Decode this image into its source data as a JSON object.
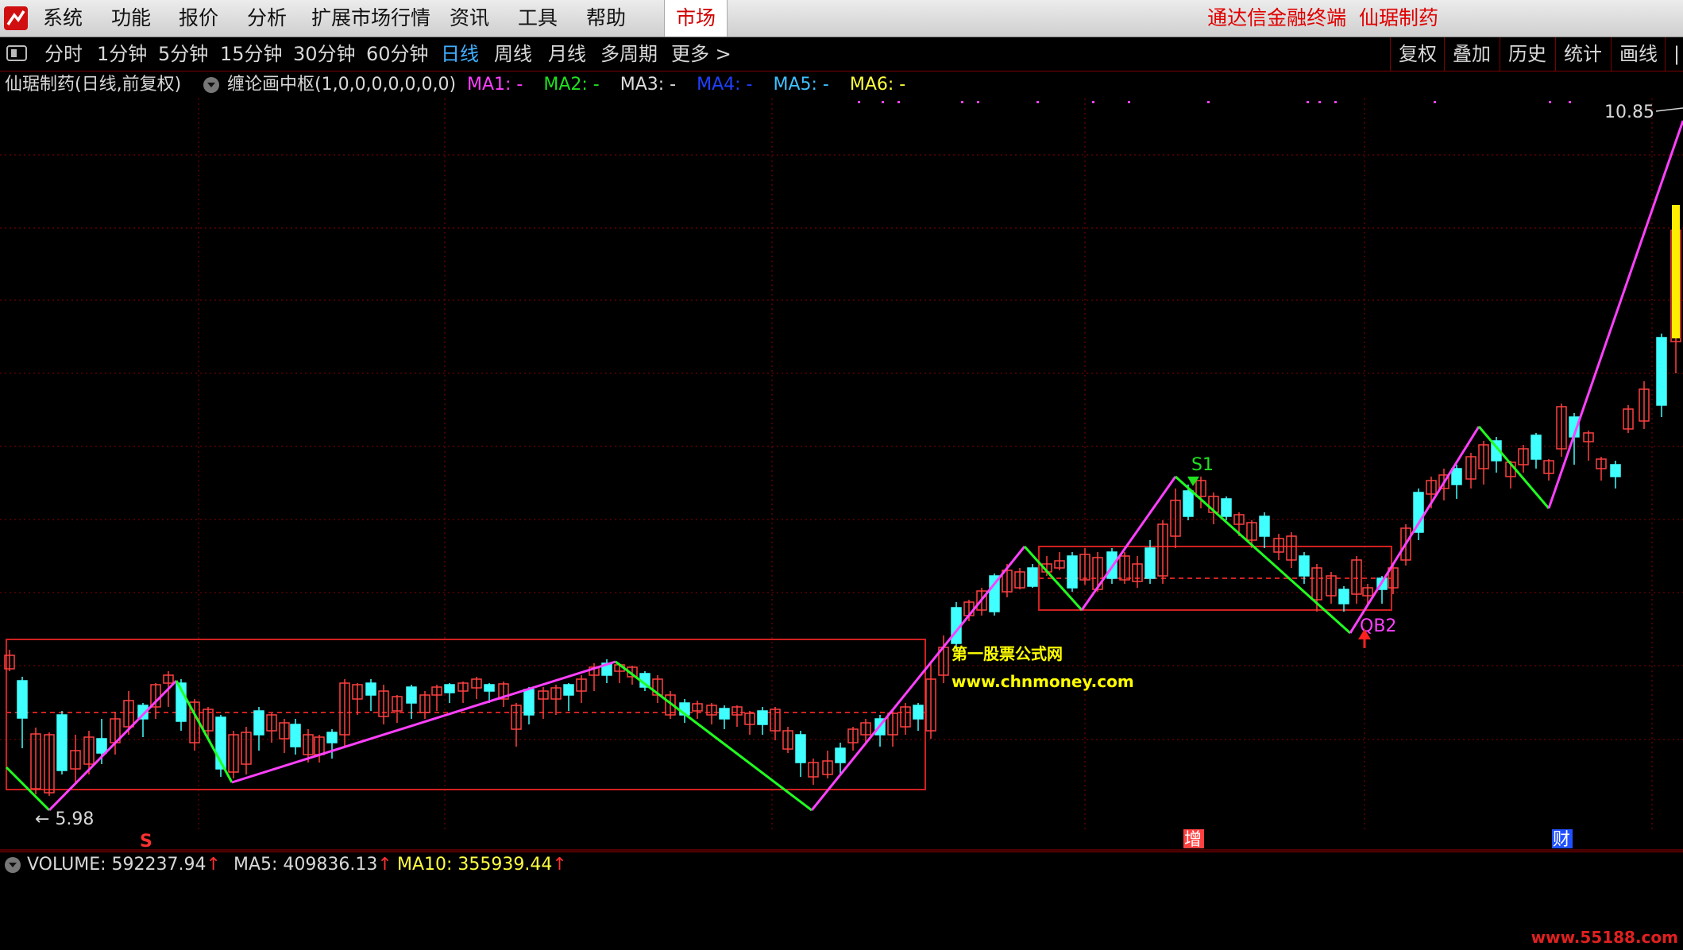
{
  "menubar": {
    "items": [
      "系统",
      "功能",
      "报价",
      "分析",
      "扩展市场行情",
      "资讯",
      "工具",
      "帮助"
    ],
    "market": "市场",
    "brand": "通达信金融终端",
    "stock": "仙琚制药"
  },
  "periods": {
    "items": [
      "分时",
      "1分钟",
      "5分钟",
      "15分钟",
      "30分钟",
      "60分钟",
      "日线",
      "周线",
      "月线",
      "多周期",
      "更多 >"
    ],
    "active": "日线"
  },
  "tools": [
    "复权",
    "叠加",
    "历史",
    "统计",
    "画线",
    "|"
  ],
  "infobar": {
    "title": "仙琚制药(日线,前复权)",
    "indicator": "缠论画中枢(1,0,0,0,0,0,0,0)",
    "ma_labels": [
      {
        "text": "MA1: -",
        "color": "#ff40ff"
      },
      {
        "text": "MA2: -",
        "color": "#20e020"
      },
      {
        "text": "MA3: -",
        "color": "#dddddd"
      },
      {
        "text": "MA4: -",
        "color": "#2040ff"
      },
      {
        "text": "MA5: -",
        "color": "#40c0ff"
      },
      {
        "text": "MA6: -",
        "color": "#ffff40"
      }
    ]
  },
  "chart_data": {
    "type": "candlestick",
    "price_high_label": "10.85",
    "price_low_label": "5.98",
    "signal_top": "S1",
    "signal_buy": "QB2",
    "event_markers": [
      "S",
      "增",
      "财"
    ],
    "overlay_text": [
      "第一股票公式网",
      "www.chnmoney.com"
    ],
    "colors": {
      "up": "#ff4040",
      "down": "#40ffff",
      "stroke_up": "#ff40ff",
      "stroke_down": "#20ff20",
      "grid": "#8a0000",
      "pivot": "#d02020"
    }
  },
  "volume": {
    "volume": "VOLUME: 592237.94",
    "ma5": "MA5: 409836.13",
    "ma10": "MA10: 355939.44"
  },
  "watermark": "www.55188.com"
}
